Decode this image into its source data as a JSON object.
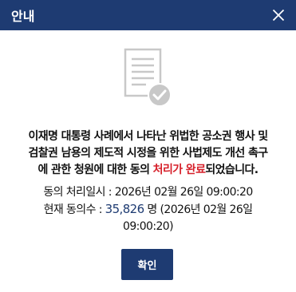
{
  "dialog": {
    "title": "안내",
    "close_icon": "close-icon",
    "status_icon": "document-check-icon",
    "message": {
      "line1": "이재명 대통령 사례에서 나타난 위법한 공소권 행사 및",
      "line2": "검찰권 남용의 제도적 시정을 위한 사법제도 개선 촉구",
      "line3_prefix": "에 관한 청원에 대한 동의 ",
      "line3_highlight": "처리가 완료",
      "line3_suffix": "되었습니다."
    },
    "info": {
      "processed_label": "동의 처리일시 : 2026년 02월 26일 09:00:20",
      "current_prefix": "현재 동의수 : ",
      "current_count": "35,826",
      "current_suffix": " 명 (2026년 02월 26일",
      "current_time": "09:00:20)"
    },
    "confirm_label": "확인"
  },
  "colors": {
    "header_bg": "#1e3b72",
    "highlight": "#d6202a",
    "count": "#1e3b72",
    "icon_gray": "#c8c8c8"
  }
}
